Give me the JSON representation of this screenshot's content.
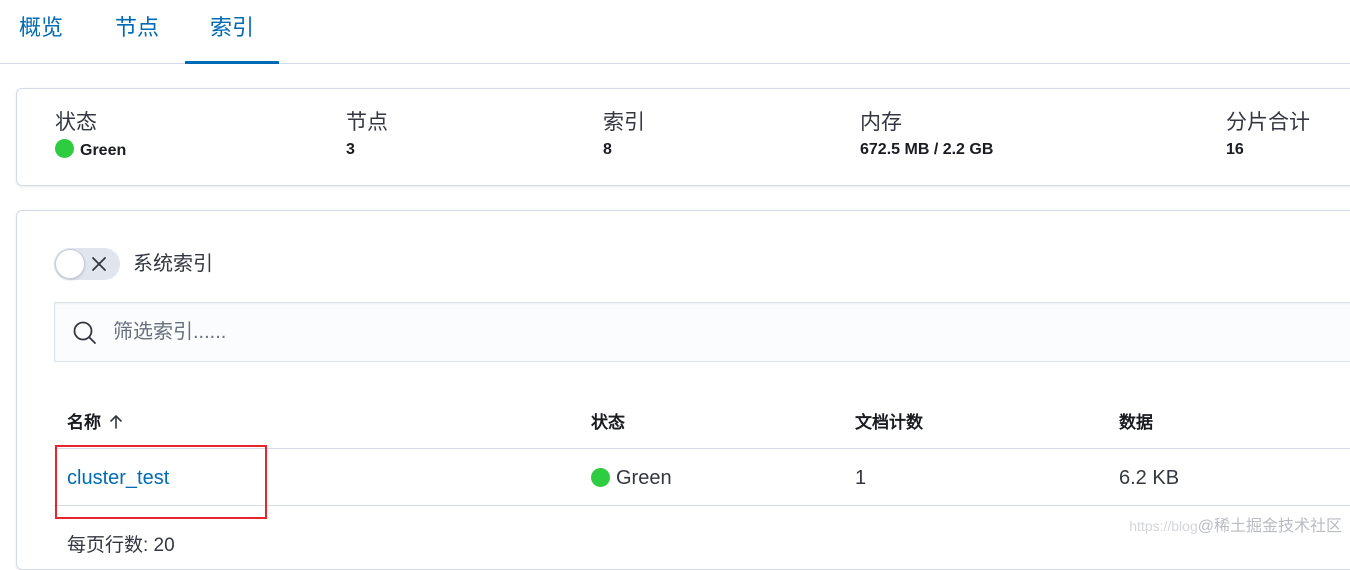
{
  "tabs": [
    {
      "label": "概览"
    },
    {
      "label": "节点"
    },
    {
      "label": "索引",
      "active": true
    }
  ],
  "summary": {
    "status": {
      "label": "状态",
      "value": "Green",
      "color": "#2ecc40"
    },
    "nodes": {
      "label": "节点",
      "value": "3"
    },
    "indices": {
      "label": "索引",
      "value": "8"
    },
    "memory": {
      "label": "内存",
      "value": "672.5 MB / 2.2 GB"
    },
    "shards": {
      "label": "分片合计",
      "value": "16"
    }
  },
  "toggle": {
    "label": "系统索引",
    "checked": false
  },
  "search": {
    "placeholder": "筛选索引......",
    "value": ""
  },
  "table": {
    "headers": [
      "名称",
      "状态",
      "文档计数",
      "数据"
    ],
    "sort": {
      "column": "名称",
      "direction": "asc"
    },
    "rows": [
      {
        "name": "cluster_test",
        "status": "Green",
        "docs": "1",
        "data": "6.2 KB"
      }
    ]
  },
  "pagination": {
    "label": "每页行数: 20"
  },
  "watermark": {
    "prefix": "https://blog",
    "text": "@稀土掘金技术社区"
  },
  "colors": {
    "accent": "#006bb4",
    "status_green": "#2ecc40",
    "highlight": "#e8242f"
  }
}
